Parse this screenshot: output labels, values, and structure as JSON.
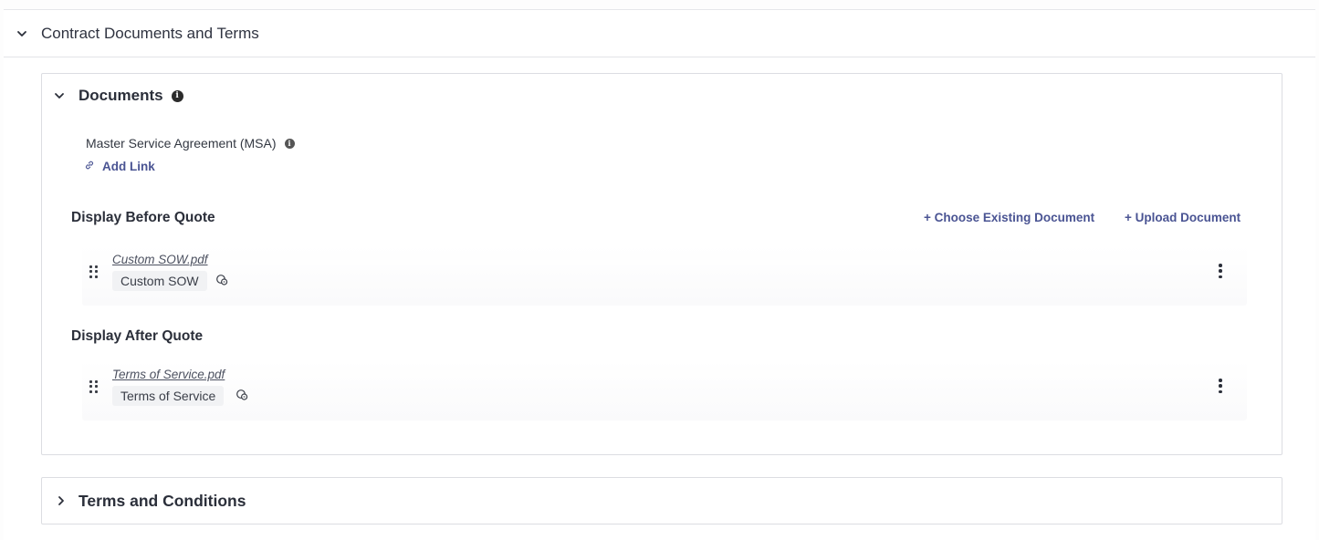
{
  "section": {
    "title": "Contract Documents and Terms",
    "expanded": true
  },
  "documents": {
    "title": "Documents",
    "msa_label": "Master Service Agreement (MSA)",
    "add_link_label": "Add Link",
    "before_label": "Display Before Quote",
    "after_label": "Display After Quote",
    "choose_existing_label": "+ Choose Existing Document",
    "upload_label": "+ Upload Document",
    "before_docs": [
      {
        "file": "Custom SOW.pdf",
        "name": "Custom SOW"
      }
    ],
    "after_docs": [
      {
        "file": "Terms of Service.pdf",
        "name": "Terms of Service"
      }
    ]
  },
  "terms": {
    "title": "Terms and Conditions",
    "expanded": false
  },
  "colors": {
    "accent": "#4a5493",
    "text": "#2b2f3a",
    "border": "#dcdde2",
    "chip_bg": "#f1f2f4"
  },
  "icons": [
    "chevron-down-icon",
    "info-icon",
    "link-icon",
    "drag-handle-icon",
    "link-badge-icon",
    "more-vertical-icon",
    "chevron-right-icon"
  ]
}
